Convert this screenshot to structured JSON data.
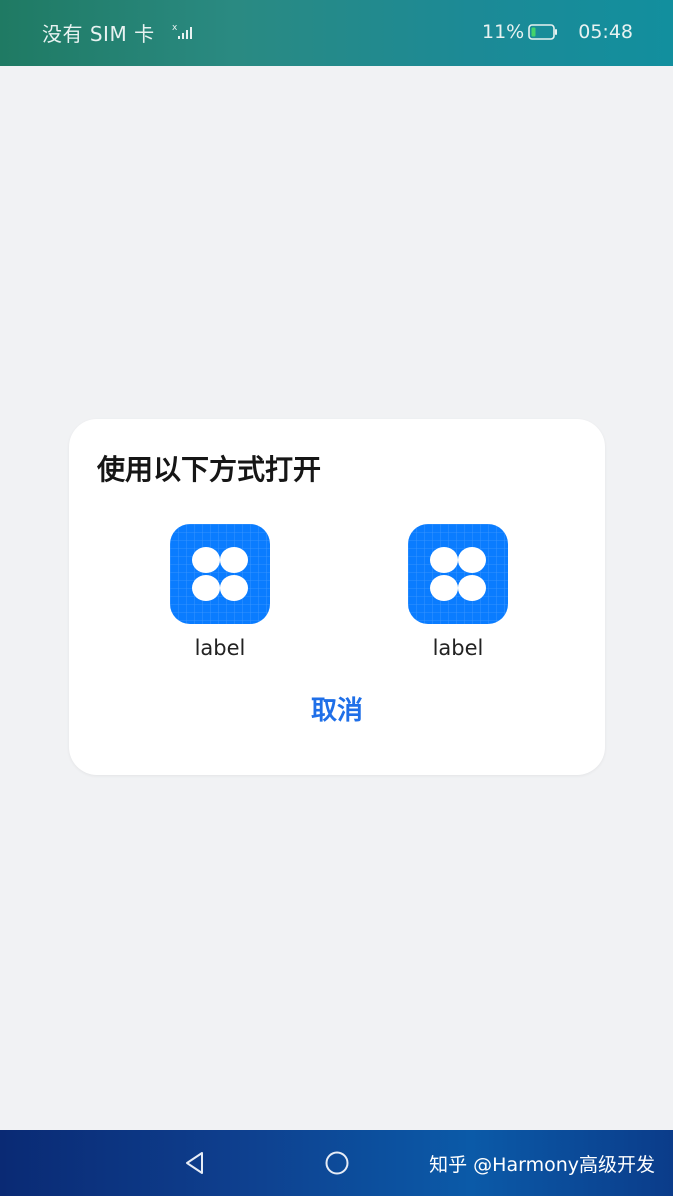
{
  "status_bar": {
    "carrier": "没有 SIM 卡",
    "battery": "11%",
    "time": "05:48",
    "icons": [
      "signal-icon",
      "battery-icon"
    ]
  },
  "dialog": {
    "title": "使用以下方式打开",
    "options": [
      {
        "label": "label",
        "icon": "app-icon"
      },
      {
        "label": "label",
        "icon": "app-icon"
      }
    ],
    "cancel": "取消",
    "accent_color": "#1f6fe8",
    "icon_color": "#0a7cff"
  },
  "nav_bar": {
    "icons": [
      "back-icon",
      "home-icon"
    ],
    "watermark": "知乎 @Harmony高级开发"
  }
}
